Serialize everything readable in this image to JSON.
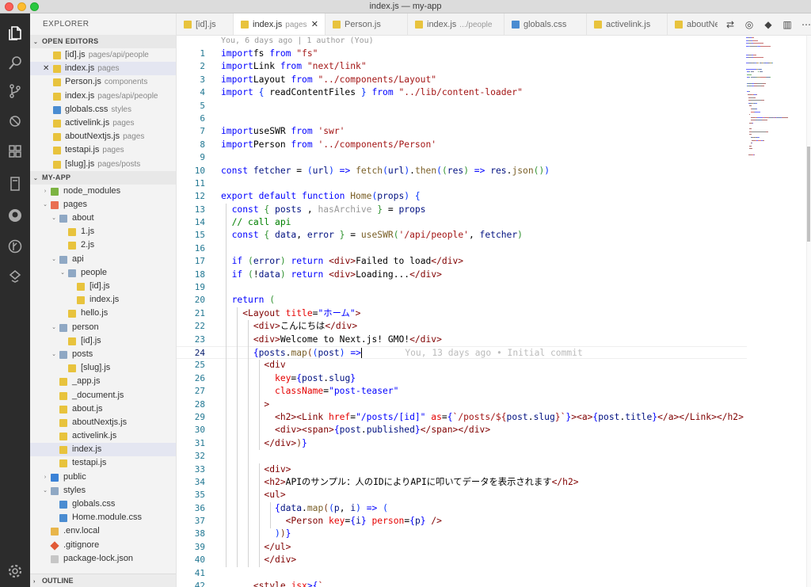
{
  "window": {
    "title": "index.js — my-app"
  },
  "activity": [
    "files-icon",
    "search-icon",
    "source-control-icon",
    "debug-icon",
    "extensions-icon",
    "remote-explorer-icon",
    "github-icon",
    "gitlens-icon",
    "live-share-icon",
    "settings-gear-icon"
  ],
  "sidebar": {
    "title": "EXPLORER",
    "open_editors_label": "OPEN EDITORS",
    "open_editors": [
      {
        "name": "[id].js",
        "desc": "pages/api/people",
        "icon": "js"
      },
      {
        "name": "index.js",
        "desc": "pages",
        "icon": "js",
        "close": "✕"
      },
      {
        "name": "Person.js",
        "desc": "components",
        "icon": "js"
      },
      {
        "name": "index.js",
        "desc": "pages/api/people",
        "icon": "js"
      },
      {
        "name": "globals.css",
        "desc": "styles",
        "icon": "css"
      },
      {
        "name": "activelink.js",
        "desc": "pages",
        "icon": "js"
      },
      {
        "name": "aboutNextjs.js",
        "desc": "pages",
        "icon": "js"
      },
      {
        "name": "testapi.js",
        "desc": "pages",
        "icon": "js"
      },
      {
        "name": "[slug].js",
        "desc": "pages/posts",
        "icon": "js"
      }
    ],
    "project_label": "MY-APP",
    "tree": [
      {
        "name": "node_modules",
        "depth": 0,
        "twisty": "›",
        "icon": "node"
      },
      {
        "name": "pages",
        "depth": 0,
        "twisty": "⌄",
        "icon": "pages"
      },
      {
        "name": "about",
        "depth": 1,
        "twisty": "⌄",
        "icon": "folder"
      },
      {
        "name": "1.js",
        "depth": 2,
        "icon": "js"
      },
      {
        "name": "2.js",
        "depth": 2,
        "icon": "js"
      },
      {
        "name": "api",
        "depth": 1,
        "twisty": "⌄",
        "icon": "folder"
      },
      {
        "name": "people",
        "depth": 2,
        "twisty": "⌄",
        "icon": "folder"
      },
      {
        "name": "[id].js",
        "depth": 3,
        "icon": "js"
      },
      {
        "name": "index.js",
        "depth": 3,
        "icon": "js"
      },
      {
        "name": "hello.js",
        "depth": 2,
        "icon": "js"
      },
      {
        "name": "person",
        "depth": 1,
        "twisty": "⌄",
        "icon": "folder"
      },
      {
        "name": "[id].js",
        "depth": 2,
        "icon": "js"
      },
      {
        "name": "posts",
        "depth": 1,
        "twisty": "⌄",
        "icon": "folder"
      },
      {
        "name": "[slug].js",
        "depth": 2,
        "icon": "js"
      },
      {
        "name": "_app.js",
        "depth": 1,
        "icon": "js"
      },
      {
        "name": "_document.js",
        "depth": 1,
        "icon": "js"
      },
      {
        "name": "about.js",
        "depth": 1,
        "icon": "js"
      },
      {
        "name": "aboutNextjs.js",
        "depth": 1,
        "icon": "js"
      },
      {
        "name": "activelink.js",
        "depth": 1,
        "icon": "js"
      },
      {
        "name": "index.js",
        "depth": 1,
        "icon": "js",
        "selected": true
      },
      {
        "name": "testapi.js",
        "depth": 1,
        "icon": "js"
      },
      {
        "name": "public",
        "depth": 0,
        "twisty": "›",
        "icon": "public"
      },
      {
        "name": "styles",
        "depth": 0,
        "twisty": "⌄",
        "icon": "folder"
      },
      {
        "name": "globals.css",
        "depth": 1,
        "icon": "css"
      },
      {
        "name": "Home.module.css",
        "depth": 1,
        "icon": "css"
      },
      {
        "name": ".env.local",
        "depth": 0,
        "icon": "env"
      },
      {
        "name": ".gitignore",
        "depth": 0,
        "icon": "git"
      },
      {
        "name": "package-lock.json",
        "depth": 0,
        "icon": "json"
      }
    ],
    "outline_label": "OUTLINE"
  },
  "tabs": [
    {
      "name": "[id].js",
      "desc": "",
      "icon": "js"
    },
    {
      "name": "index.js",
      "desc": "pages",
      "icon": "js",
      "active": true,
      "close": "✕"
    },
    {
      "name": "Person.js",
      "desc": "",
      "icon": "js"
    },
    {
      "name": "index.js",
      "desc": ".../people",
      "icon": "js"
    },
    {
      "name": "globals.css",
      "desc": "",
      "icon": "css"
    },
    {
      "name": "activelink.js",
      "desc": "",
      "icon": "js"
    },
    {
      "name": "aboutNextjs",
      "desc": "",
      "icon": "js"
    }
  ],
  "tab_actions": [
    "compare-icon",
    "open-changes-icon",
    "git-commit-icon",
    "split-editor-icon",
    "more-actions-icon"
  ],
  "editor": {
    "codelens": "You, 6 days ago | 1 author (You)",
    "current_line": 24,
    "lines": [
      [
        [
          "k",
          "import"
        ],
        [
          "",
          "fs "
        ],
        [
          "k",
          "from"
        ],
        [
          "s",
          " \"fs\""
        ]
      ],
      [
        [
          "k",
          "import"
        ],
        [
          "",
          "Link "
        ],
        [
          "k",
          "from"
        ],
        [
          "s",
          " \"next/link\""
        ]
      ],
      [
        [
          "k",
          "import"
        ],
        [
          "",
          "Layout "
        ],
        [
          "k",
          "from"
        ],
        [
          "s",
          " \"../components/Layout\""
        ]
      ],
      [
        [
          "k",
          "import"
        ],
        [
          "p1",
          " { "
        ],
        [
          "",
          "readContentFiles "
        ],
        [
          "p1",
          "} "
        ],
        [
          "k",
          "from"
        ],
        [
          "s",
          " \"../lib/content-loader\""
        ]
      ],
      [],
      [],
      [
        [
          "k",
          "import"
        ],
        [
          "",
          "useSWR "
        ],
        [
          "k",
          "from"
        ],
        [
          "s",
          " 'swr'"
        ]
      ],
      [
        [
          "k",
          "import"
        ],
        [
          "",
          "Person "
        ],
        [
          "k",
          "from"
        ],
        [
          "s",
          " '../components/Person'"
        ]
      ],
      [],
      [
        [
          "k",
          "const"
        ],
        [
          "n",
          " fetcher"
        ],
        [
          "",
          " = "
        ],
        [
          "p1",
          "("
        ],
        [
          "n",
          "url"
        ],
        [
          "p1",
          ")"
        ],
        [
          "k",
          " =>"
        ],
        [
          "f",
          " fetch"
        ],
        [
          "p1",
          "("
        ],
        [
          "n",
          "url"
        ],
        [
          "p1",
          ")"
        ],
        [
          "",
          "."
        ],
        [
          "f",
          "then"
        ],
        [
          "p1",
          "("
        ],
        [
          "p2",
          "("
        ],
        [
          "n",
          "res"
        ],
        [
          "p2",
          ")"
        ],
        [
          "k",
          " =>"
        ],
        [
          "n",
          " res"
        ],
        [
          "",
          "."
        ],
        [
          "f",
          "json"
        ],
        [
          "p2",
          "()"
        ],
        [
          "p1",
          ")"
        ]
      ],
      [],
      [
        [
          "k",
          "export default function "
        ],
        [
          "f",
          "Home"
        ],
        [
          "p1",
          "("
        ],
        [
          "n",
          "props"
        ],
        [
          "p1",
          ")"
        ],
        [
          "p1",
          " {"
        ]
      ],
      [
        [
          "g",
          "  "
        ],
        [
          "k",
          "const"
        ],
        [
          "p2",
          " { "
        ],
        [
          "n",
          "posts"
        ],
        [
          "",
          " , "
        ],
        [
          "g",
          "hasArchive"
        ],
        [
          "p2",
          " }"
        ],
        [
          "",
          " = "
        ],
        [
          "n",
          "props"
        ]
      ],
      [
        [
          "g",
          "  "
        ],
        [
          "c",
          "// call api"
        ]
      ],
      [
        [
          "g",
          "  "
        ],
        [
          "k",
          "const"
        ],
        [
          "p2",
          " { "
        ],
        [
          "n",
          "data"
        ],
        [
          "",
          ", "
        ],
        [
          "n",
          "error"
        ],
        [
          "p2",
          " }"
        ],
        [
          "",
          " = "
        ],
        [
          "f",
          "useSWR"
        ],
        [
          "p2",
          "("
        ],
        [
          "s",
          "'/api/people'"
        ],
        [
          "",
          ", "
        ],
        [
          "n",
          "fetcher"
        ],
        [
          "p2",
          ")"
        ]
      ],
      [],
      [
        [
          "g",
          "  "
        ],
        [
          "k",
          "if"
        ],
        [
          "p2",
          " ("
        ],
        [
          "n",
          "error"
        ],
        [
          "p2",
          ")"
        ],
        [
          "k",
          " return"
        ],
        [
          "tag",
          " <div>"
        ],
        [
          "",
          "Failed to load"
        ],
        [
          "tag",
          "</div>"
        ]
      ],
      [
        [
          "g",
          "  "
        ],
        [
          "k",
          "if"
        ],
        [
          "p2",
          " ("
        ],
        [
          "",
          "!"
        ],
        [
          "n",
          "data"
        ],
        [
          "p2",
          ")"
        ],
        [
          "k",
          " return"
        ],
        [
          "tag",
          " <div>"
        ],
        [
          "",
          "Loading..."
        ],
        [
          "tag",
          "</div>"
        ]
      ],
      [],
      [
        [
          "g",
          "  "
        ],
        [
          "k",
          "return"
        ],
        [
          "p2",
          " ("
        ]
      ],
      [
        [
          "g",
          "    "
        ],
        [
          "tag",
          "<Layout "
        ],
        [
          "at",
          "title"
        ],
        [
          "",
          "="
        ],
        [
          "k",
          "\"ホーム\""
        ],
        [
          "tag",
          ">"
        ]
      ],
      [
        [
          "g",
          "      "
        ],
        [
          "tag",
          "<div>"
        ],
        [
          "",
          "こんにちは"
        ],
        [
          "tag",
          "</div>"
        ]
      ],
      [
        [
          "g",
          "      "
        ],
        [
          "tag",
          "<div>"
        ],
        [
          "",
          "Welcome to Next.js! GMO!"
        ],
        [
          "tag",
          "</div>"
        ]
      ],
      [
        [
          "g",
          "      "
        ],
        [
          "k",
          "{"
        ],
        [
          "n",
          "posts"
        ],
        [
          "",
          "."
        ],
        [
          "f",
          "map"
        ],
        [
          "p3",
          "("
        ],
        [
          "p1",
          "("
        ],
        [
          "n",
          "post"
        ],
        [
          "p1",
          ")"
        ],
        [
          "k",
          " =>"
        ],
        [
          "cursor",
          ""
        ],
        [
          "blame",
          "        You, 13 days ago • Initial commit"
        ]
      ],
      [
        [
          "g",
          "        "
        ],
        [
          "tag",
          "<div"
        ]
      ],
      [
        [
          "g",
          "          "
        ],
        [
          "at",
          "key"
        ],
        [
          "",
          "="
        ],
        [
          "k",
          "{"
        ],
        [
          "n",
          "post"
        ],
        [
          "",
          "."
        ],
        [
          "n",
          "slug"
        ],
        [
          "k",
          "}"
        ]
      ],
      [
        [
          "g",
          "          "
        ],
        [
          "at",
          "className"
        ],
        [
          "",
          "="
        ],
        [
          "k",
          "\"post-teaser\""
        ]
      ],
      [
        [
          "g",
          "        "
        ],
        [
          "tag",
          ">"
        ]
      ],
      [
        [
          "g",
          "          "
        ],
        [
          "tag",
          "<h2><Link "
        ],
        [
          "at",
          "href"
        ],
        [
          "",
          "="
        ],
        [
          "k",
          "\"/posts/[id]\""
        ],
        [
          "at",
          " as"
        ],
        [
          "",
          "="
        ],
        [
          "k",
          "{"
        ],
        [
          "s",
          "`/posts/${"
        ],
        [
          "n",
          "post"
        ],
        [
          "",
          "."
        ],
        [
          "n",
          "slug"
        ],
        [
          "s",
          "}`"
        ],
        [
          "k",
          "}"
        ],
        [
          "tag",
          ">"
        ],
        [
          "tag",
          "<a>"
        ],
        [
          "k",
          "{"
        ],
        [
          "n",
          "post"
        ],
        [
          "",
          "."
        ],
        [
          "n",
          "title"
        ],
        [
          "k",
          "}"
        ],
        [
          "tag",
          "</a></Link></h2>"
        ]
      ],
      [
        [
          "g",
          "          "
        ],
        [
          "tag",
          "<div><span>"
        ],
        [
          "k",
          "{"
        ],
        [
          "n",
          "post"
        ],
        [
          "",
          "."
        ],
        [
          "n",
          "published"
        ],
        [
          "k",
          "}"
        ],
        [
          "tag",
          "</span></div>"
        ]
      ],
      [
        [
          "g",
          "        "
        ],
        [
          "tag",
          "</div>"
        ],
        [
          "p3",
          ")"
        ],
        [
          "k",
          "}"
        ]
      ],
      [],
      [
        [
          "g",
          "        "
        ],
        [
          "tag",
          "<div>"
        ]
      ],
      [
        [
          "g",
          "        "
        ],
        [
          "tag",
          "<h2>"
        ],
        [
          "",
          "APIのサンプル：人のIDによりAPIに叩いてデータを表示されます"
        ],
        [
          "tag",
          "</h2>"
        ]
      ],
      [
        [
          "g",
          "        "
        ],
        [
          "tag",
          "<ul>"
        ]
      ],
      [
        [
          "g",
          "          "
        ],
        [
          "k",
          "{"
        ],
        [
          "n",
          "data"
        ],
        [
          "",
          "."
        ],
        [
          "f",
          "map"
        ],
        [
          "p3",
          "("
        ],
        [
          "p1",
          "("
        ],
        [
          "n",
          "p"
        ],
        [
          "",
          ", "
        ],
        [
          "n",
          "i"
        ],
        [
          "p1",
          ")"
        ],
        [
          "k",
          " =>"
        ],
        [
          "p1",
          " ("
        ]
      ],
      [
        [
          "g",
          "            "
        ],
        [
          "tag",
          "<Person "
        ],
        [
          "at",
          "key"
        ],
        [
          "",
          "="
        ],
        [
          "k",
          "{"
        ],
        [
          "n",
          "i"
        ],
        [
          "k",
          "}"
        ],
        [
          "at",
          " person"
        ],
        [
          "",
          "="
        ],
        [
          "k",
          "{"
        ],
        [
          "n",
          "p"
        ],
        [
          "k",
          "}"
        ],
        [
          "tag",
          " />"
        ]
      ],
      [
        [
          "g",
          "          "
        ],
        [
          "p1",
          ")"
        ],
        [
          "p3",
          ")"
        ],
        [
          "k",
          "}"
        ]
      ],
      [
        [
          "g",
          "        "
        ],
        [
          "tag",
          "</ul>"
        ]
      ],
      [
        [
          "g",
          "        "
        ],
        [
          "tag",
          "</div>"
        ]
      ],
      [],
      [
        [
          "g",
          "      "
        ],
        [
          "tag",
          "<style "
        ],
        [
          "at",
          "jsx"
        ],
        [
          "k",
          ">{"
        ],
        [
          "s",
          "`"
        ]
      ]
    ]
  }
}
